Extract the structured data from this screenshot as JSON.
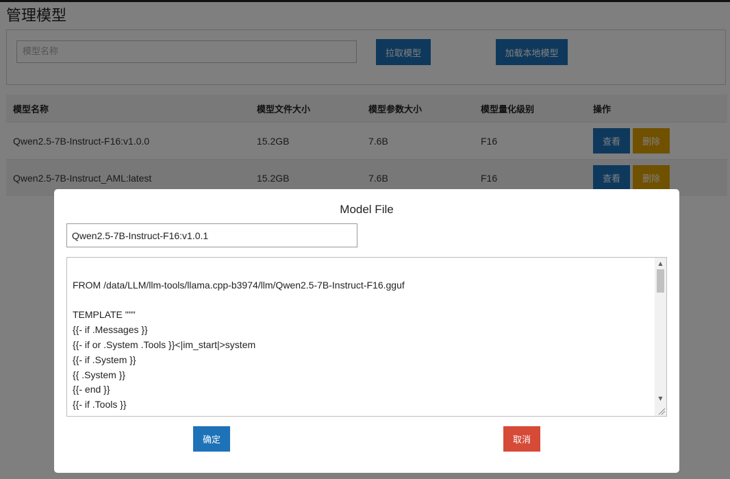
{
  "page": {
    "title": "管理模型"
  },
  "search": {
    "placeholder": "模型名称",
    "pull_button": "拉取模型",
    "load_local_button": "加载本地模型"
  },
  "table": {
    "headers": [
      "模型名称",
      "模型文件大小",
      "模型参数大小",
      "模型量化级别",
      "操作"
    ],
    "rows": [
      {
        "name": "Qwen2.5-7B-Instruct-F16:v1.0.0",
        "file_size": "15.2GB",
        "param_size": "7.6B",
        "quant": "F16",
        "view": "查看",
        "delete": "删除"
      },
      {
        "name": "Qwen2.5-7B-Instruct_AML:latest",
        "file_size": "15.2GB",
        "param_size": "7.6B",
        "quant": "F16",
        "view": "查看",
        "delete": "删除"
      }
    ]
  },
  "modal": {
    "title": "Model File",
    "name_value": "Qwen2.5-7B-Instruct-F16:v1.0.1",
    "lines": [
      "",
      "FROM /data/LLM/llm-tools/llama.cpp-b3974/llm/Qwen2.5-7B-Instruct-F16.gguf",
      "",
      "TEMPLATE \"\"\"",
      "{{- if .Messages }}",
      "{{- if or .System .Tools }}<|im_start|>system",
      "{{- if .System }}",
      "{{ .System }}",
      "{{- end }}",
      "{{- if .Tools }}"
    ],
    "confirm_button": "确定",
    "cancel_button": "取消"
  },
  "colors": {
    "primary": "#1e72b8",
    "warning": "#e0a200",
    "danger": "#d64a38"
  },
  "icons": {
    "scroll_up": "triangle-up",
    "scroll_down": "triangle-down",
    "resize": "resize-grip"
  }
}
